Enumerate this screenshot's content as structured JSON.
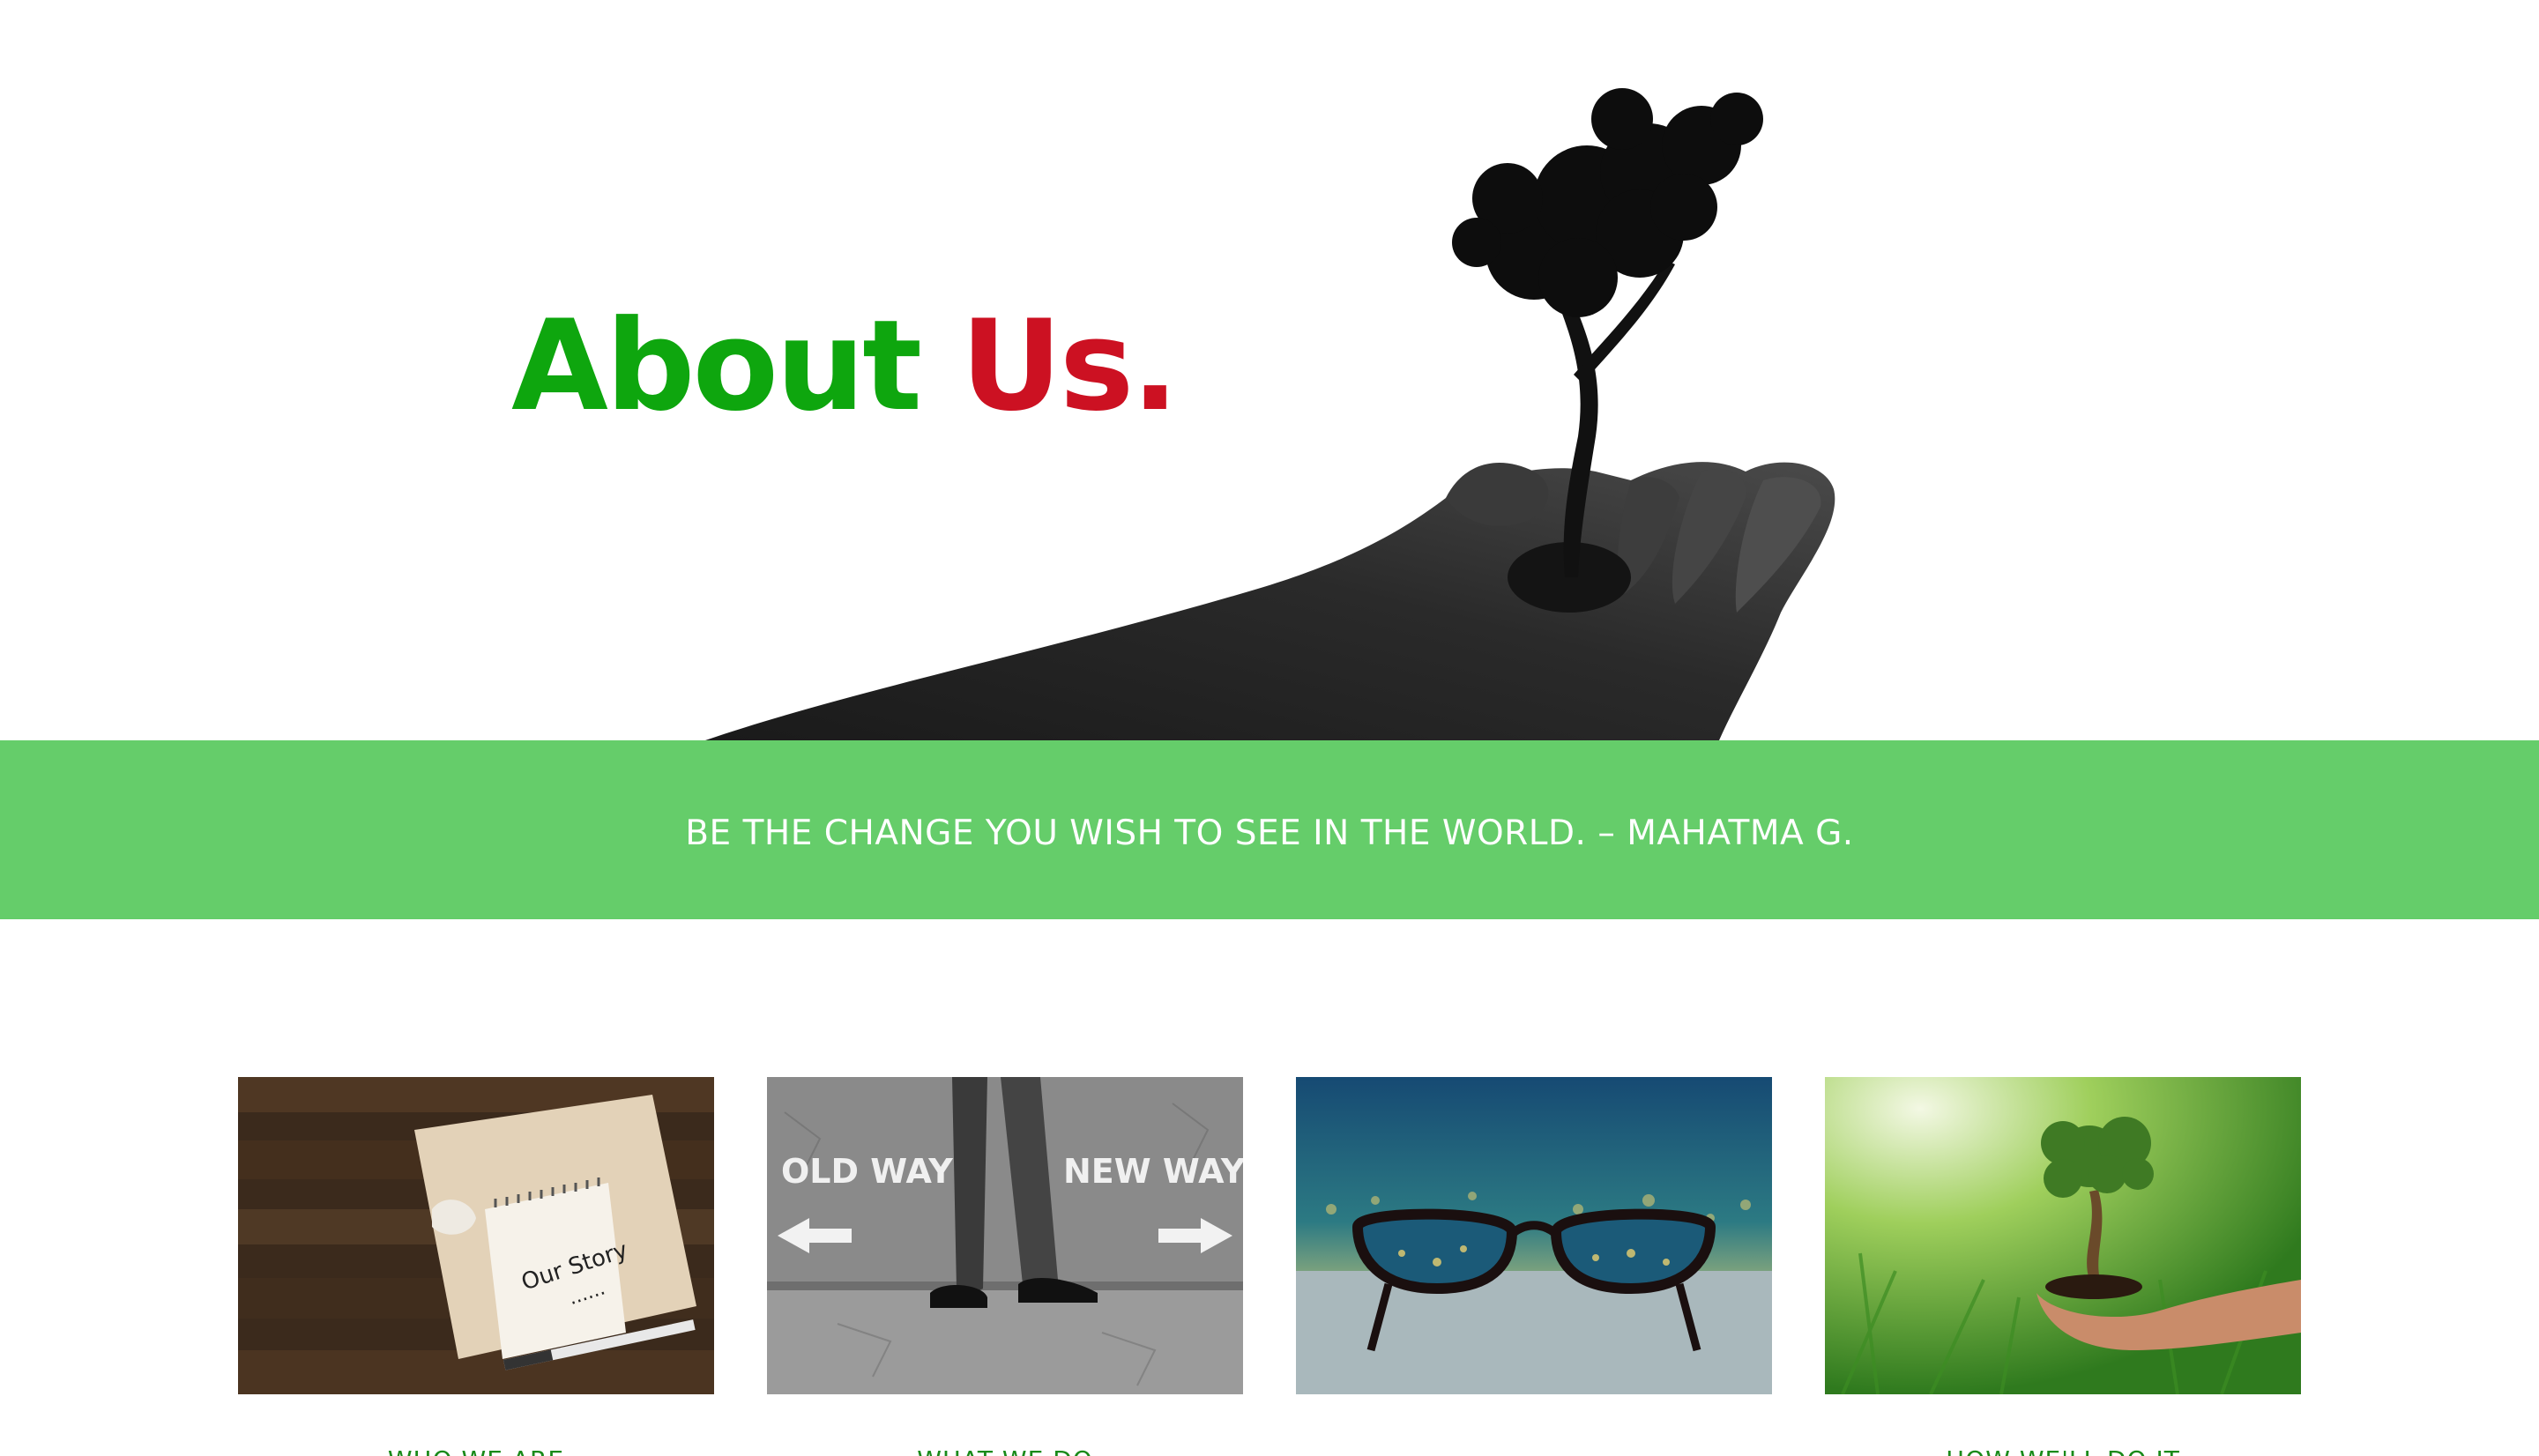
{
  "hero": {
    "title_word_1": "About",
    "title_word_2": "Us.",
    "illustration": "hand-holding-tree-image"
  },
  "quote": {
    "text": "BE THE CHANGE YOU WISH TO SEE IN THE WORLD. – MAHATMA G."
  },
  "cards": [
    {
      "image": "our-story-notebook-image",
      "image_text": "Our Story",
      "caption": "WHO WE ARE"
    },
    {
      "image": "old-way-new-way-image",
      "image_text_left": "OLD WAY",
      "image_text_right": "NEW WAY",
      "caption": "WHAT WE DO"
    },
    {
      "image": "glasses-city-vision-image",
      "caption": ""
    },
    {
      "image": "hands-holding-tree-image",
      "caption": "HOW WE'LL DO IT"
    }
  ],
  "colors": {
    "green_accent": "#0ea60e",
    "red_accent": "#cc1122",
    "band_green": "#65cd6a",
    "caption_green": "#1a8a1a"
  }
}
